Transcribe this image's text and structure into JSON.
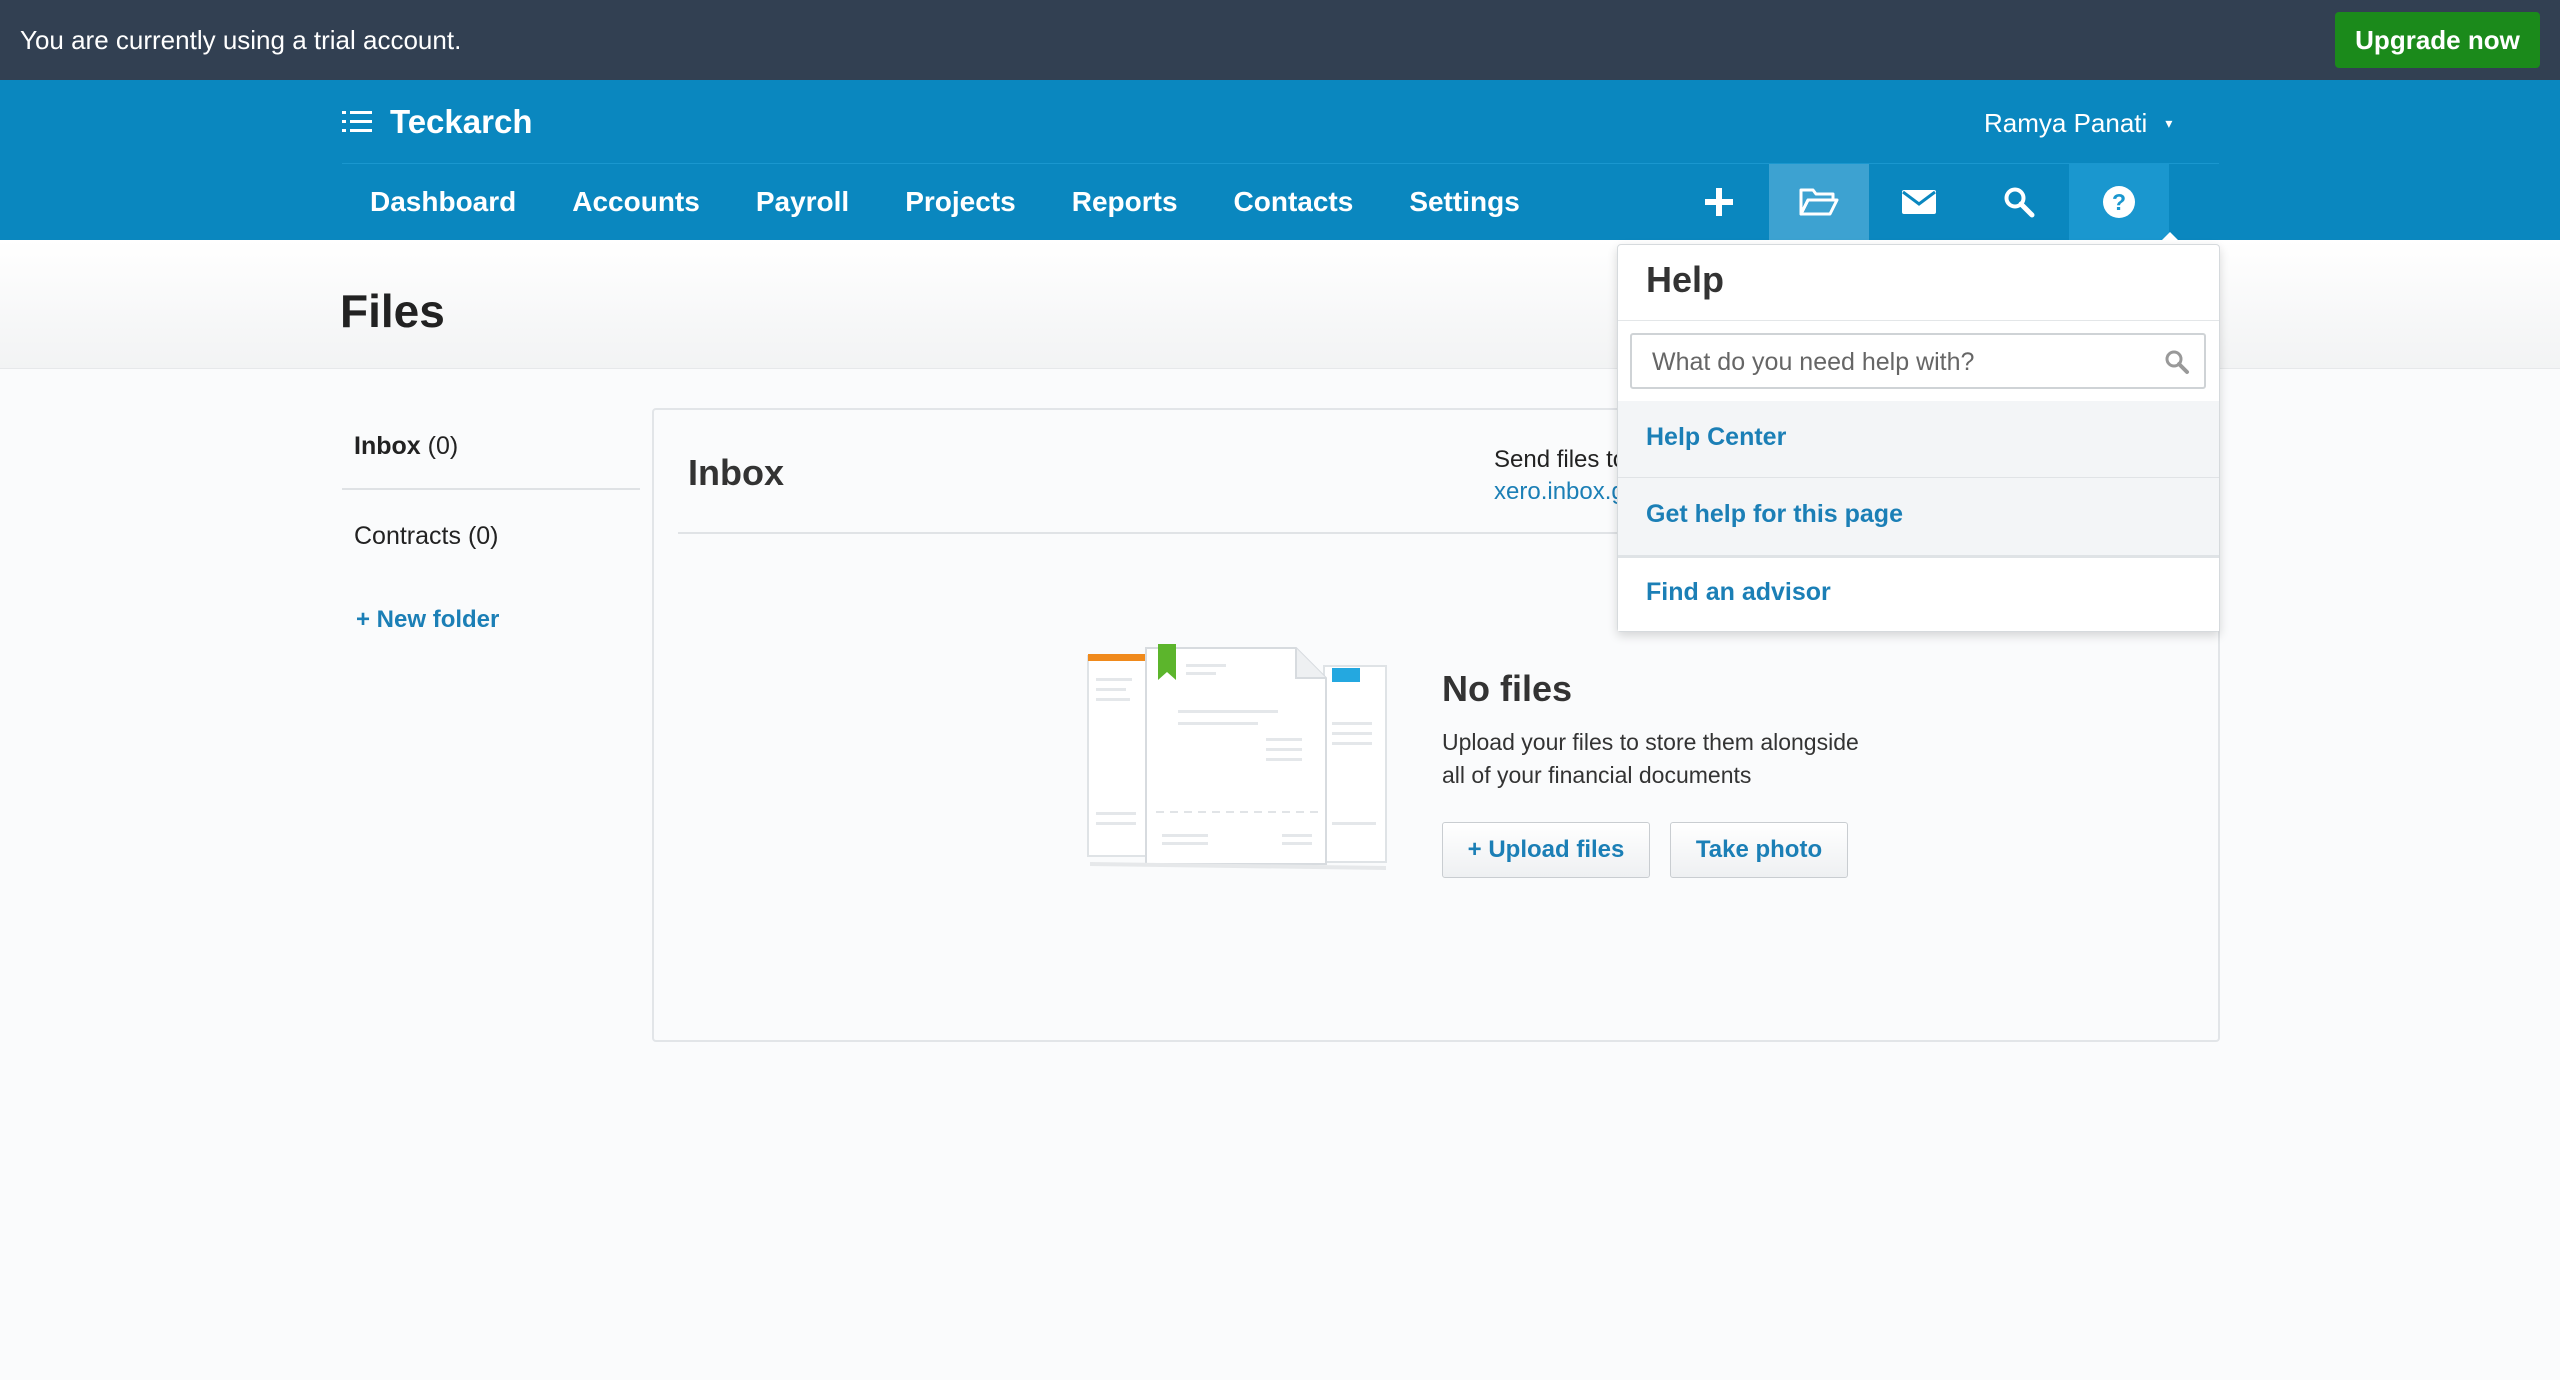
{
  "trial_bar": {
    "message": "You are currently using a trial account.",
    "upgrade_label": "Upgrade now",
    "upgrade_color": "#1b8a1b"
  },
  "header": {
    "org_icon": "list-menu-icon",
    "org_name": "Teckarch",
    "user_name": "Ramya Panati",
    "user_caret": "▾",
    "nav": [
      {
        "label": "Dashboard"
      },
      {
        "label": "Accounts"
      },
      {
        "label": "Payroll"
      },
      {
        "label": "Projects"
      },
      {
        "label": "Reports"
      },
      {
        "label": "Contacts"
      },
      {
        "label": "Settings"
      }
    ],
    "tools": [
      "plus-icon",
      "folder-open-icon",
      "mail-icon",
      "search-icon",
      "help-icon"
    ],
    "brand_color": "#0a87bf"
  },
  "page": {
    "title": "Files"
  },
  "sidebar": {
    "folders": [
      {
        "name": "Inbox",
        "count": "(0)"
      },
      {
        "name": "Contracts",
        "count": "(0)"
      }
    ],
    "new_folder_label": "+ New folder"
  },
  "panel": {
    "title": "Inbox",
    "send_text": "Send files to",
    "send_email": "xero.inbox.g",
    "empty_title": "No files",
    "empty_line1": "Upload your files to store them alongside",
    "empty_line2": "all of your financial documents",
    "upload_label": "+ Upload files",
    "photo_label": "Take photo"
  },
  "help": {
    "title": "Help",
    "search_placeholder": "What do you need help with?",
    "links": [
      "Help Center",
      "Get help for this page",
      "Find an advisor"
    ]
  }
}
